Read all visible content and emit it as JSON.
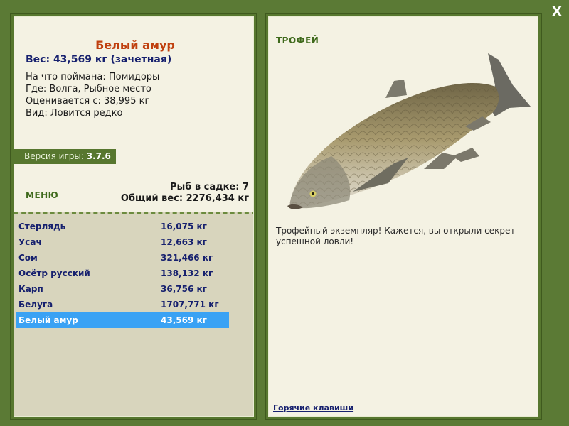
{
  "close_label": "X",
  "fish": {
    "name": "Белый амур",
    "weight_line": "Вес: 43,569 кг (зачетная)",
    "bait_line": "На что поймана: Помидоры",
    "place_line": "Где: Волга, Рыбное место",
    "value_line": "Оценивается с: 38,995 кг",
    "kind_line": "Вид: Ловится редко"
  },
  "version": {
    "label": "Версия игры:",
    "value": "3.7.6"
  },
  "menu_label": "МЕНЮ",
  "stats": {
    "count_line": "Рыб в садке: 7",
    "total_line": "Общий вес: 2276,434 кг"
  },
  "catch_list": [
    {
      "name": "Стерлядь",
      "weight": "16,075 кг"
    },
    {
      "name": "Усач",
      "weight": "12,663 кг"
    },
    {
      "name": "Сом",
      "weight": "321,466 кг"
    },
    {
      "name": "Осётр русский",
      "weight": "138,132 кг"
    },
    {
      "name": "Карп",
      "weight": "36,756 кг"
    },
    {
      "name": "Белуга",
      "weight": "1707,771 кг"
    },
    {
      "name": "Белый амур",
      "weight": "43,569 кг"
    }
  ],
  "trophy": {
    "label": "ТРОФЕЙ",
    "text": "Трофейный экземпляр! Кажется, вы открыли секрет успешной ловли!",
    "icon": "grass-carp-image"
  },
  "hotkeys_label": "Горячие клавиши",
  "colors": {
    "frame": "#5b7a35",
    "panel": "#f4f2e3",
    "selected": "#3aa2f4",
    "title": "#c0400f",
    "text_blue": "#16206e"
  }
}
